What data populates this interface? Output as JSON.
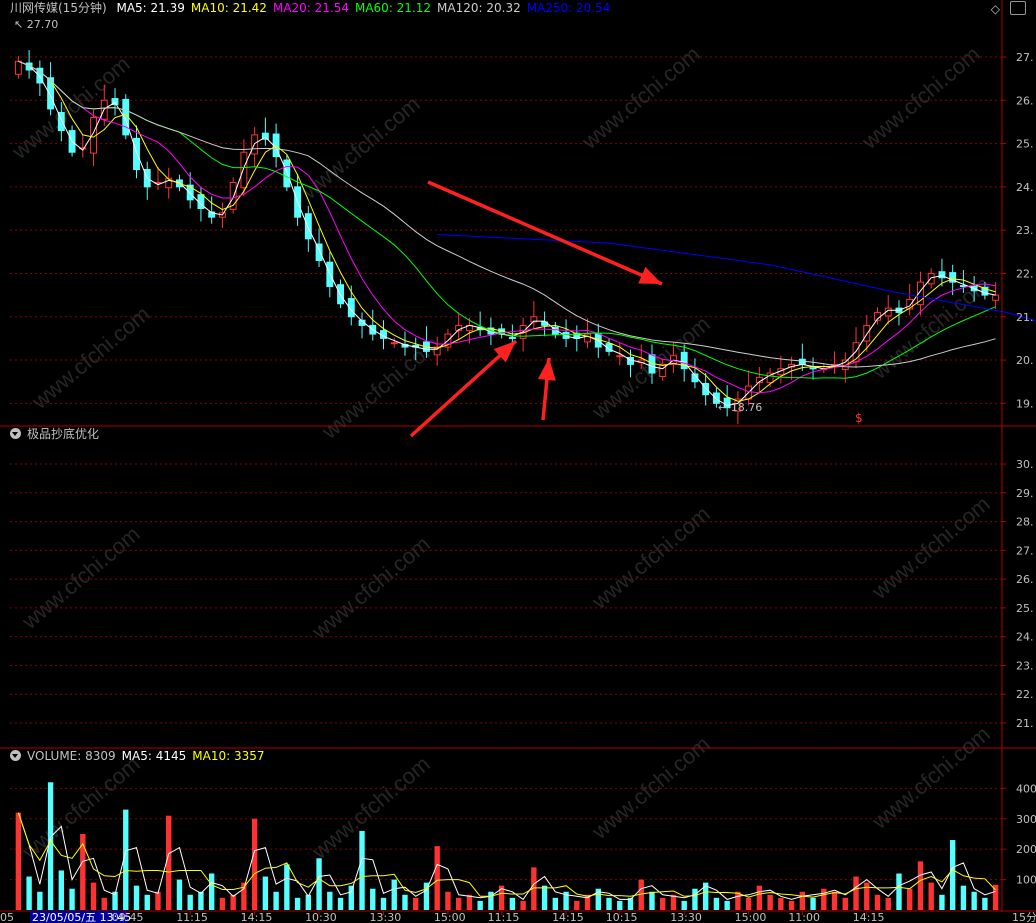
{
  "title": {
    "name": "川网传媒(15分钟)"
  },
  "price_legend": [
    {
      "label": "MA5: 21.39",
      "color": "#ffffff"
    },
    {
      "label": "MA10: 21.42",
      "color": "#ffff00"
    },
    {
      "label": "MA20: 21.54",
      "color": "#ff00ff"
    },
    {
      "label": "MA60: 21.12",
      "color": "#00ff00"
    },
    {
      "label": "MA120: 20.32",
      "color": "#cccccc"
    },
    {
      "label": "MA250: 20.54",
      "color": "#0000ff"
    }
  ],
  "indicator": {
    "name": "极品抄底优化"
  },
  "volume_legend": [
    {
      "label": "VOLUME: 8309",
      "color": "#c0c0c0"
    },
    {
      "label": "MA5: 4145",
      "color": "#ffffff"
    },
    {
      "label": "MA10: 3357",
      "color": "#ffff00"
    }
  ],
  "annotations": {
    "high": "27.70",
    "low": "18.76",
    "marker": "$"
  },
  "bottom_axis": {
    "date_label": "23/05/05/五 13:45",
    "left_cut": "05",
    "right_cut": "15分"
  },
  "watermark": "www.cfchi.com",
  "colors": {
    "up": "#ff3232",
    "down": "#54ffff",
    "grid": "#8b0000",
    "axis": "#b00000",
    "axis_text": "#c0c0c0"
  },
  "chart_data": [
    {
      "type": "candlestick",
      "title": "川网传媒(15分钟)",
      "ylim": [
        18.5,
        27.9
      ],
      "yticks": [
        19,
        20,
        21,
        22,
        23,
        24,
        25,
        26,
        27
      ],
      "ytick_labels": [
        "19.",
        "20.",
        "21.",
        "22.",
        "23.",
        "24.",
        "25.",
        "26.",
        "27."
      ],
      "x_tick_labels": [
        "09:45",
        "11:15",
        "14:15",
        "10:30",
        "13:30",
        "15:00",
        "11:15",
        "14:15",
        "10:15",
        "13:30",
        "15:00",
        "11:00",
        "14:15"
      ],
      "close": [
        26.9,
        26.7,
        26.4,
        25.8,
        25.3,
        24.8,
        24.9,
        25.6,
        26.0,
        25.9,
        25.2,
        24.4,
        24.0,
        24.1,
        24.2,
        24.0,
        23.7,
        23.5,
        23.3,
        23.4,
        24.1,
        24.8,
        25.2,
        25.1,
        24.7,
        24.0,
        23.3,
        22.8,
        22.3,
        21.7,
        21.3,
        21.0,
        20.8,
        20.6,
        20.5,
        20.4,
        20.3,
        20.3,
        20.2,
        20.3,
        20.6,
        20.8,
        20.8,
        20.7,
        20.6,
        20.6,
        20.5,
        20.8,
        21.0,
        20.8,
        20.6,
        20.5,
        20.5,
        20.6,
        20.3,
        20.2,
        20.1,
        19.9,
        20.0,
        19.7,
        19.9,
        20.1,
        19.8,
        19.5,
        19.2,
        19.0,
        18.9,
        19.1,
        19.4,
        19.6,
        19.7,
        19.8,
        19.9,
        19.9,
        19.8,
        19.8,
        19.9,
        20.0,
        20.4,
        20.8,
        21.1,
        21.2,
        21.1,
        21.4,
        21.8,
        22.0,
        21.9,
        21.8,
        21.7,
        21.6,
        21.5,
        21.5
      ],
      "series": [
        {
          "name": "MA5",
          "latest": 21.39,
          "color": "#ffffff"
        },
        {
          "name": "MA10",
          "latest": 21.42,
          "color": "#ffff00"
        },
        {
          "name": "MA20",
          "latest": 21.54,
          "color": "#ff00ff"
        },
        {
          "name": "MA60",
          "latest": 21.12,
          "color": "#00ff00"
        },
        {
          "name": "MA120",
          "latest": 20.32,
          "color": "#cccccc"
        },
        {
          "name": "MA250",
          "latest": 20.54,
          "color": "#0000ff",
          "points": [
            [
              39,
              22.9
            ],
            [
              55,
              22.7
            ],
            [
              70,
              22.2
            ],
            [
              81,
              21.6
            ],
            [
              92,
              21.1
            ],
            [
              99,
              20.6
            ]
          ]
        }
      ]
    },
    {
      "type": "line",
      "title": "极品抄底优化",
      "ylim": [
        20.2,
        30.8
      ],
      "yticks": [
        21,
        22,
        23,
        24,
        25,
        26,
        27,
        28,
        29,
        30
      ],
      "ytick_labels": [
        "21.",
        "22.",
        "23.",
        "24.",
        "25.",
        "26.",
        "27.",
        "28.",
        "29.",
        "30."
      ],
      "series": []
    },
    {
      "type": "bar",
      "title": "VOLUME",
      "ylim": [
        0,
        480
      ],
      "yticks": [
        100,
        200,
        300,
        400
      ],
      "ytick_labels": [
        "100",
        "200",
        "300",
        "400"
      ],
      "values": [
        320,
        110,
        60,
        420,
        130,
        70,
        250,
        90,
        40,
        60,
        330,
        80,
        50,
        60,
        310,
        100,
        50,
        60,
        120,
        40,
        50,
        90,
        300,
        110,
        60,
        150,
        40,
        50,
        170,
        60,
        40,
        80,
        260,
        70,
        40,
        100,
        50,
        40,
        90,
        210,
        60,
        40,
        50,
        30,
        60,
        80,
        40,
        30,
        140,
        80,
        40,
        60,
        30,
        50,
        70,
        40,
        30,
        40,
        100,
        60,
        40,
        50,
        30,
        70,
        90,
        40,
        30,
        60,
        40,
        80,
        50,
        40,
        30,
        60,
        40,
        70,
        60,
        40,
        110,
        90,
        50,
        40,
        120,
        70,
        160,
        90,
        50,
        230,
        80,
        60,
        40,
        83
      ],
      "series": [
        {
          "name": "MA5",
          "latest": 4145,
          "color": "#ffffff"
        },
        {
          "name": "MA10",
          "latest": 3357,
          "color": "#ffff00"
        }
      ]
    }
  ]
}
